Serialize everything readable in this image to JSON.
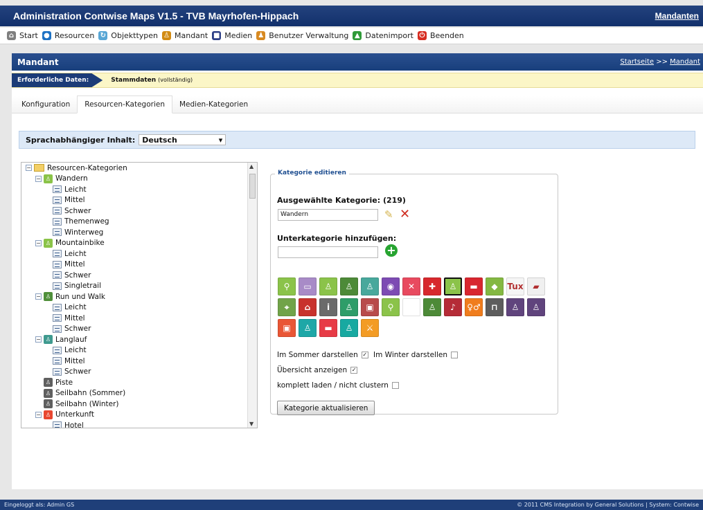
{
  "app": {
    "title": "Administration Contwise Maps V1.5 - TVB Mayrhofen-Hippach",
    "top_link": "Mandanten"
  },
  "menu": [
    {
      "label": "Start",
      "icon": "home-icon",
      "color": "#7f7f7f"
    },
    {
      "label": "Resourcen",
      "icon": "globe-icon",
      "color": "#1e72c4"
    },
    {
      "label": "Objekttypen",
      "icon": "refresh-icon",
      "color": "#58a6d5"
    },
    {
      "label": "Mandant",
      "icon": "user-icon",
      "color": "#d28b13"
    },
    {
      "label": "Medien",
      "icon": "media-icon",
      "color": "#2d3f87"
    },
    {
      "label": "Benutzer Verwaltung",
      "icon": "users-icon",
      "color": "#d88a22"
    },
    {
      "label": "Datenimport",
      "icon": "import-icon",
      "color": "#2f9a38"
    },
    {
      "label": "Beenden",
      "icon": "power-icon",
      "color": "#d72d21"
    }
  ],
  "panel": {
    "title": "Mandant",
    "breadcrumb": {
      "home": "Startseite",
      "separator": ">>",
      "current": "Mandant"
    }
  },
  "required": {
    "label": "Erforderliche Daten:",
    "value": "Stammdaten",
    "note": "(vollständig)"
  },
  "tabs": [
    {
      "label": "Konfiguration",
      "active": false
    },
    {
      "label": "Resourcen-Kategorien",
      "active": true
    },
    {
      "label": "Medien-Kategorien",
      "active": false
    }
  ],
  "language": {
    "label": "Sprachabhängiger Inhalt:",
    "value": "Deutsch"
  },
  "tree": {
    "root": "Resourcen-Kategorien",
    "nodes": [
      {
        "level": 1,
        "label": "Wandern",
        "color": "#8ac348",
        "icon": "hiking-icon",
        "expanded": true
      },
      {
        "level": 2,
        "label": "Leicht"
      },
      {
        "level": 2,
        "label": "Mittel"
      },
      {
        "level": 2,
        "label": "Schwer"
      },
      {
        "level": 2,
        "label": "Themenweg"
      },
      {
        "level": 2,
        "label": "Winterweg"
      },
      {
        "level": 1,
        "label": "Mountainbike",
        "color": "#8ac348",
        "icon": "bike-icon",
        "expanded": true
      },
      {
        "level": 2,
        "label": "Leicht"
      },
      {
        "level": 2,
        "label": "Mittel"
      },
      {
        "level": 2,
        "label": "Schwer"
      },
      {
        "level": 2,
        "label": "Singletrail"
      },
      {
        "level": 1,
        "label": "Run und Walk",
        "color": "#4f8f3a",
        "icon": "runner-icon",
        "expanded": true
      },
      {
        "level": 2,
        "label": "Leicht"
      },
      {
        "level": 2,
        "label": "Mittel"
      },
      {
        "level": 2,
        "label": "Schwer"
      },
      {
        "level": 1,
        "label": "Langlauf",
        "color": "#3f9a8f",
        "icon": "cross-country-icon",
        "expanded": true
      },
      {
        "level": 2,
        "label": "Leicht"
      },
      {
        "level": 2,
        "label": "Mittel"
      },
      {
        "level": 2,
        "label": "Schwer"
      },
      {
        "level": 1,
        "label": "Piste",
        "color": "#5f5f5f",
        "icon": "ski-lift-icon",
        "expanded": false
      },
      {
        "level": 1,
        "label": "Seilbahn (Sommer)",
        "color": "#5f5f5f",
        "icon": "cable-car-icon",
        "expanded": false
      },
      {
        "level": 1,
        "label": "Seilbahn (Winter)",
        "color": "#5f5f5f",
        "icon": "cable-car-icon",
        "expanded": false
      },
      {
        "level": 1,
        "label": "Unterkunft",
        "color": "#e84730",
        "icon": "bed-icon",
        "expanded": true
      },
      {
        "level": 2,
        "label": "Hotel"
      }
    ]
  },
  "editor": {
    "legend": "Kategorie editieren",
    "selected_label": "Ausgewählte Kategorie: (219)",
    "selected_value": "Wandern",
    "add_label": "Unterkategorie hinzufügen:",
    "add_value": "",
    "icons": [
      {
        "name": "bike-icon",
        "color": "#8bc34a",
        "glyph": "⚲",
        "selected": false
      },
      {
        "name": "speech-bubble-icon",
        "color": "#a88bc7",
        "glyph": "▭",
        "selected": false
      },
      {
        "name": "climbing-icon",
        "color": "#8bc34a",
        "glyph": "♙",
        "selected": false
      },
      {
        "name": "walker-icon",
        "color": "#4d8a38",
        "glyph": "♙",
        "selected": false
      },
      {
        "name": "ski-tour-icon",
        "color": "#48a89c",
        "glyph": "♙",
        "selected": false
      },
      {
        "name": "eye-icon",
        "color": "#7d4bb3",
        "glyph": "◉",
        "selected": false
      },
      {
        "name": "restaurant-icon",
        "color": "#e84a5f",
        "glyph": "✕",
        "selected": false
      },
      {
        "name": "first-aid-icon",
        "color": "#d7282d",
        "glyph": "✚",
        "selected": false
      },
      {
        "name": "hiking-icon",
        "color": "#8bc34a",
        "glyph": "♙",
        "selected": true
      },
      {
        "name": "brand-logo-icon",
        "color": "#d8262f",
        "glyph": "▬",
        "selected": false
      },
      {
        "name": "badge-icon",
        "color": "#84b842",
        "glyph": "◆",
        "selected": false
      },
      {
        "name": "tux-logo-icon",
        "color": "#f5f5f5",
        "glyph": "Tux",
        "selected": false
      },
      {
        "name": "partner-logo-icon",
        "color": "#f0f0f0",
        "glyph": "▰",
        "selected": false
      },
      {
        "name": "map-pin-icon",
        "color": "#71a349",
        "glyph": "⌖",
        "selected": false
      },
      {
        "name": "house-icon",
        "color": "#c8322d",
        "glyph": "⌂",
        "selected": false
      },
      {
        "name": "info-icon",
        "color": "#6b6b6b",
        "glyph": "i",
        "selected": false
      },
      {
        "name": "sport-icon",
        "color": "#2e9d69",
        "glyph": "♙",
        "selected": false
      },
      {
        "name": "car-icon",
        "color": "#b84b4b",
        "glyph": "▣",
        "selected": false
      },
      {
        "name": "bike-outline-icon",
        "color": "#8bc34a",
        "glyph": "⚲",
        "selected": false
      },
      {
        "name": "empty-icon",
        "color": "#ffffff",
        "glyph": "",
        "selected": false
      },
      {
        "name": "nordic-walking-icon",
        "color": "#4d8a38",
        "glyph": "♙",
        "selected": false
      },
      {
        "name": "music-icon",
        "color": "#b52c37",
        "glyph": "♪",
        "selected": false
      },
      {
        "name": "toilet-icon",
        "color": "#f07d1d",
        "glyph": "♀♂",
        "selected": false
      },
      {
        "name": "gondola-icon",
        "color": "#5d5d5d",
        "glyph": "⊓",
        "selected": false
      },
      {
        "name": "chair-lift-icon",
        "color": "#60447d",
        "glyph": "♙",
        "selected": false
      },
      {
        "name": "ski-icon",
        "color": "#60447d",
        "glyph": "♙",
        "selected": false
      },
      {
        "name": "shopping-cart-icon",
        "color": "#e95635",
        "glyph": "▣",
        "selected": false
      },
      {
        "name": "person-icon",
        "color": "#1ea7a7",
        "glyph": "♙",
        "selected": false
      },
      {
        "name": "hotel-bed-icon",
        "color": "#e73b46",
        "glyph": "▬",
        "selected": false
      },
      {
        "name": "person-teal-icon",
        "color": "#18a9a1",
        "glyph": "♙",
        "selected": false
      },
      {
        "name": "hiking-orange-icon",
        "color": "#f39c25",
        "glyph": "⚔",
        "selected": false
      }
    ],
    "checks": [
      {
        "label": "Im Sommer darstellen",
        "checked": true
      },
      {
        "label": "Im Winter darstellen",
        "checked": false
      },
      {
        "label": "Übersicht anzeigen",
        "checked": true
      },
      {
        "label": "komplett laden / nicht clustern",
        "checked": false
      }
    ],
    "update_button": "Kategorie aktualisieren"
  },
  "footer": {
    "left": "Eingeloggt als: Admin GS",
    "right": "© 2011 CMS Integration by General Solutions | System: Contwise"
  }
}
